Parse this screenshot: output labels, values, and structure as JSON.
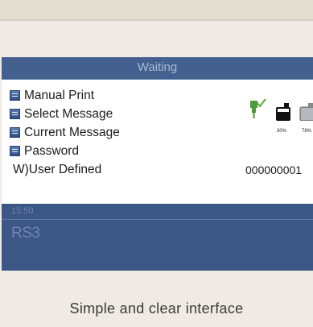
{
  "screen": {
    "title": "Waiting",
    "menu_items": [
      {
        "label": "Manual Print"
      },
      {
        "label": "Select Message"
      },
      {
        "label": "Current Message"
      },
      {
        "label": "Password"
      }
    ],
    "user_defined_label": "W)User Defined",
    "counter": "000000001",
    "status": {
      "printhead_icon": "printhead-ready-icon",
      "ink_icon": "ink-bottle-icon",
      "solvent_icon": "solvent-bottle-icon",
      "ink_level": "30%",
      "solvent_level": "78%"
    },
    "time": "15:50",
    "model": "RS3"
  },
  "caption": "Simple and clear interface",
  "colors": {
    "screen_blue": "#3c5685",
    "title_text": "#a8bad6",
    "check_green": "#5db346",
    "background": "#efebe4"
  }
}
